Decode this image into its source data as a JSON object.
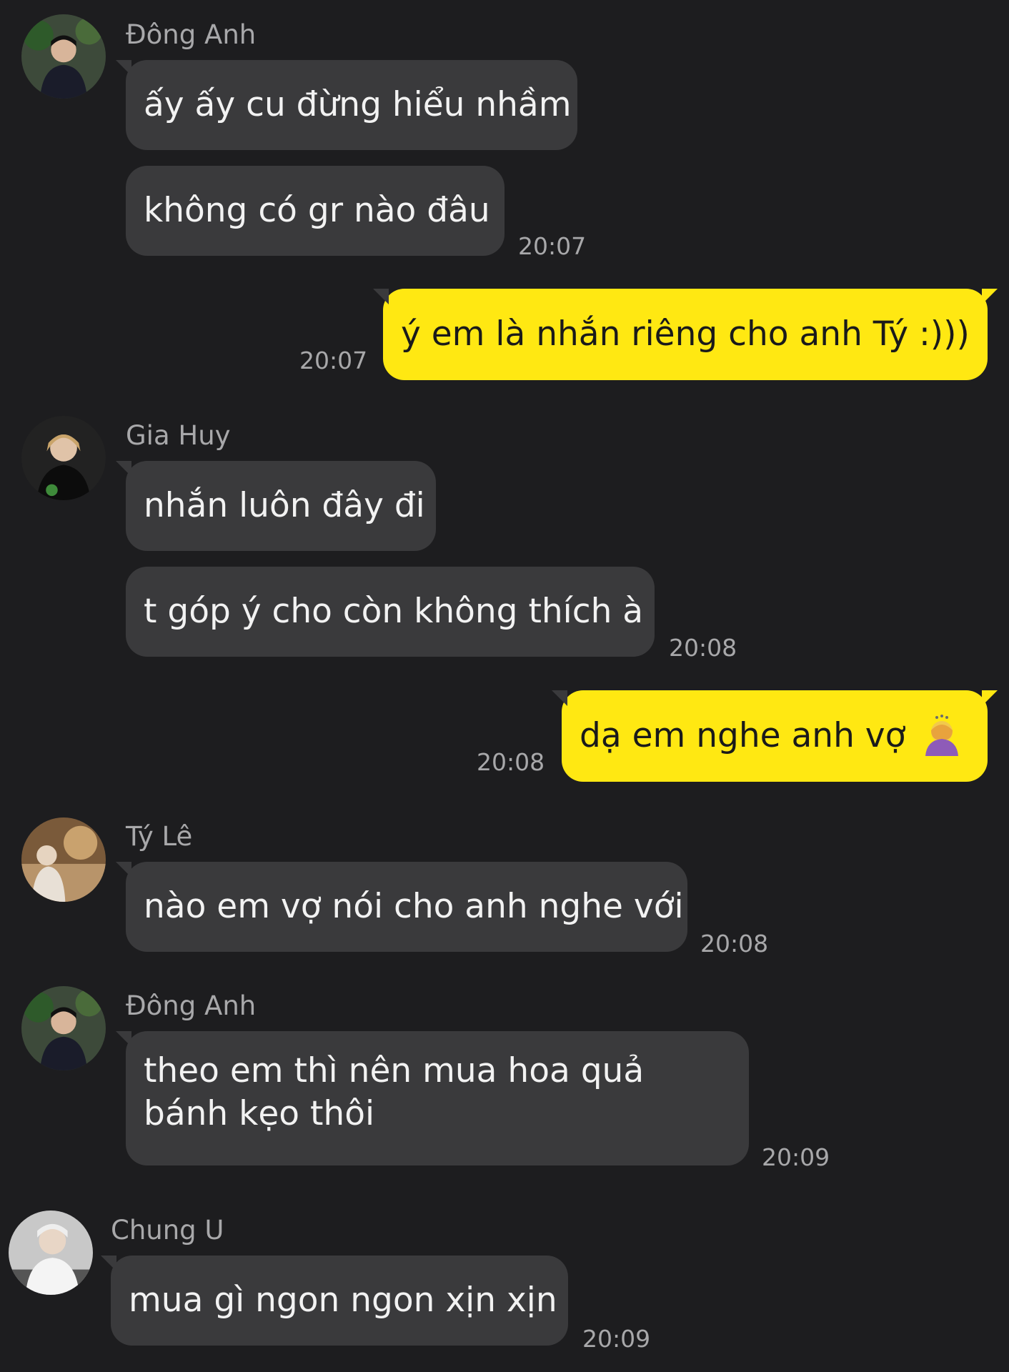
{
  "messages": [
    {
      "sender": "Đông Anh",
      "avatar": "avatar-dong-anh",
      "lines": [
        "ấy ấy cu đừng hiểu nhầm",
        "không có gr nào đâu"
      ],
      "time": "20:07"
    },
    {
      "me": true,
      "text": "ý em là nhắn riêng cho anh Tý :)))",
      "time": "20:07"
    },
    {
      "sender": "Gia Huy",
      "avatar": "avatar-gia-huy",
      "lines": [
        "nhắn luôn đây đi",
        "t góp ý cho còn không thích à"
      ],
      "time": "20:08"
    },
    {
      "me": true,
      "text": "dạ em nghe anh vợ",
      "emoji": "bowing-woman-emoji",
      "time": "20:08"
    },
    {
      "sender": "Tý Lê",
      "avatar": "avatar-ty-le",
      "lines": [
        "nào em vợ nói cho anh nghe với"
      ],
      "time": "20:08"
    },
    {
      "sender": "Đông Anh",
      "avatar": "avatar-dong-anh",
      "lines": [
        "theo em thì nên mua hoa quả bánh kẹo thôi"
      ],
      "time": "20:09"
    },
    {
      "sender": "Chung U",
      "avatar": "avatar-chung-u",
      "lines": [
        "mua gì ngon ngon xịn xịn"
      ],
      "time": "20:09"
    }
  ],
  "colors": {
    "background": "#1d1d1f",
    "incoming_bubble": "#3a3a3c",
    "outgoing_bubble": "#ffe812"
  }
}
